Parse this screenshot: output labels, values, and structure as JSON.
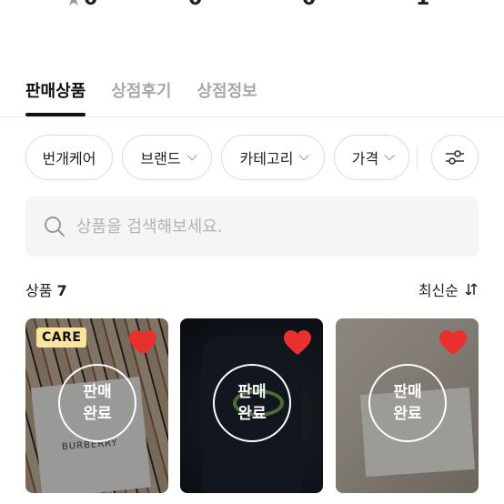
{
  "stats": [
    "0",
    "0",
    "0",
    "1"
  ],
  "tabs": [
    "판매상품",
    "상점후기",
    "상점정보"
  ],
  "filters": {
    "chips": [
      "번개케어",
      "브랜드",
      "카테고리",
      "가격"
    ]
  },
  "search": {
    "placeholder": "상품을 검색해보세요."
  },
  "products": {
    "label": "상품",
    "count": "7",
    "sort_label": "최신순"
  },
  "cards": [
    {
      "badge": "CARE",
      "status_line1": "판매",
      "status_line2": "완료",
      "image_text": "BURBERRY"
    },
    {
      "status_line1": "판매",
      "status_line2": "완료"
    },
    {
      "status_line1": "판매",
      "status_line2": "완료"
    }
  ],
  "colors": {
    "heart": "#e8312f",
    "care_badge": "#fbe4a0",
    "active_tab": "#111111",
    "inactive_tab": "#a8a8a8"
  },
  "icons": [
    "star-icon",
    "chevron-down-icon",
    "filter-sliders-icon",
    "search-icon",
    "sort-arrows-icon",
    "heart-icon"
  ]
}
